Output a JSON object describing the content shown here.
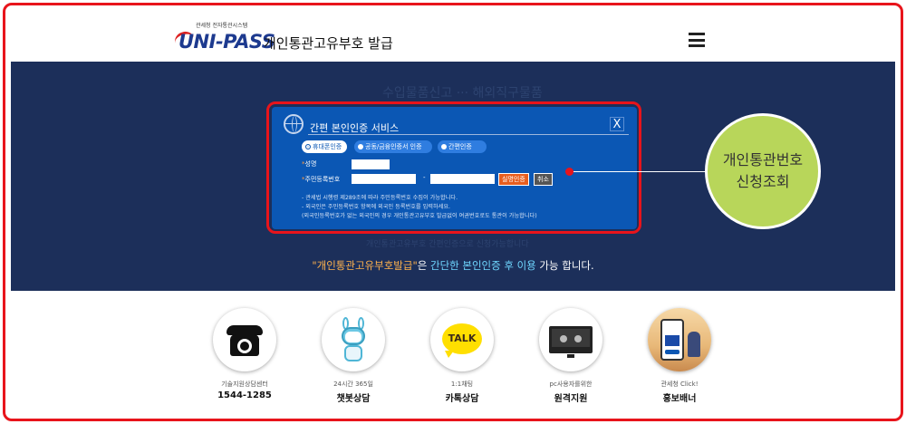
{
  "header": {
    "logo_small": "관세청 전자통관시스템",
    "logo_text": "UNI-PASS",
    "title": "개인통관고유부호 발급"
  },
  "hero": {
    "bg_text_top": "수입물품신고 ··· 해외직구물품",
    "bg_text_bottom": "개인통관고유부호 간편인증으로 신청가능합니다",
    "tagline_part1": "\"개인통관고유부호발급\"",
    "tagline_part2": "은 ",
    "tagline_part3": "간단한 본인인증 후 이용",
    "tagline_part4": " 가능 합니다."
  },
  "modal": {
    "title": "간편 본인인증 서비스",
    "close_label": "X",
    "tabs": [
      {
        "label": "휴대폰인증",
        "active": true
      },
      {
        "label": "공동/금융인증서 인증",
        "active": false
      },
      {
        "label": "간편인증",
        "active": false
      }
    ],
    "name_label": "성명",
    "rrn_label": "주민등록번호",
    "rrn_separator": "-",
    "verify_button": "실명인증",
    "cancel_button": "취소",
    "notes": [
      "- 관세법 시행령 제289조에 따라 주민등록번호 수집이 가능합니다.",
      "- 외국인은 주민등록번호 항목에 외국인 등록번호를 입력하세요.",
      "(외국인등록번호가 없는 외국인의 경우 개인통관고유부호 발급없이 여권번호로도 통관이 가능합니다)"
    ]
  },
  "callout": {
    "line1": "개인통관번호",
    "line2": "신청조회"
  },
  "services": [
    {
      "caption": "기술지원상담센터",
      "title": "1544-1285",
      "icon": "telephone-icon"
    },
    {
      "caption": "24시간 365일",
      "title": "챗봇상담",
      "icon": "chatbot-icon"
    },
    {
      "caption": "1:1채팅",
      "title": "카톡상담",
      "icon": "kakaotalk-icon"
    },
    {
      "caption": "pc사용자를위한",
      "title": "원격지원",
      "icon": "remote-support-icon"
    },
    {
      "caption": "관세청 Click!",
      "title": "홍보배너",
      "icon": "promo-banner-icon"
    }
  ],
  "talk_icon_text": "TALK",
  "colors": {
    "hero_bg": "#1c2f5a",
    "modal_bg": "#0b57b4",
    "highlight_border": "#e8141b",
    "callout_bg": "#b8d65a",
    "verify_button": "#e85e1e"
  }
}
